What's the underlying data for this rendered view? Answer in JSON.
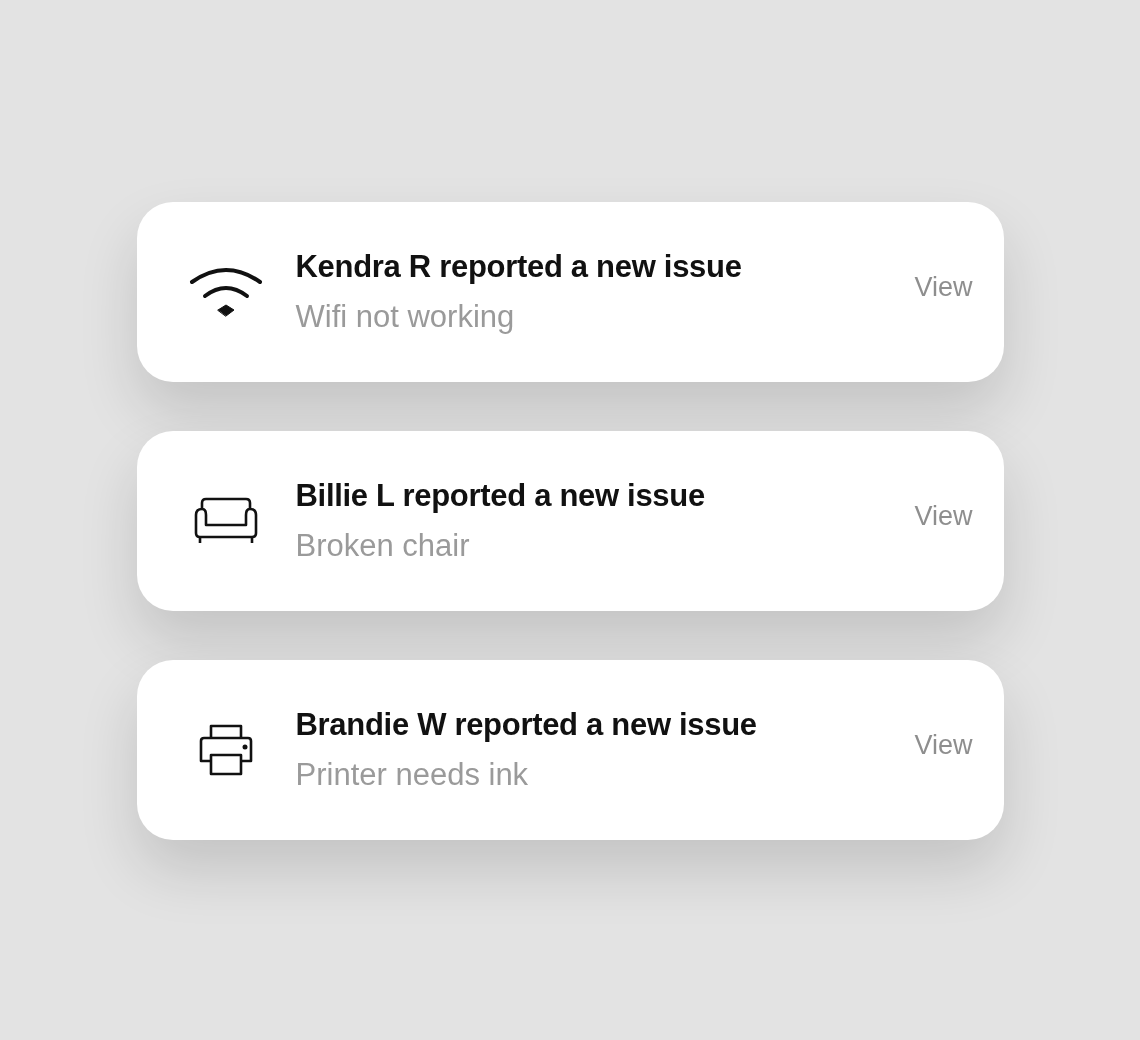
{
  "notifications": [
    {
      "kind": "wifi",
      "title": "Kendra R reported a new issue",
      "subtitle": "Wifi not working",
      "action": "View"
    },
    {
      "kind": "sofa",
      "title": "Billie L reported a new issue",
      "subtitle": "Broken chair",
      "action": "View"
    },
    {
      "kind": "printer",
      "title": "Brandie W reported a new issue",
      "subtitle": "Printer needs ink",
      "action": "View"
    }
  ]
}
